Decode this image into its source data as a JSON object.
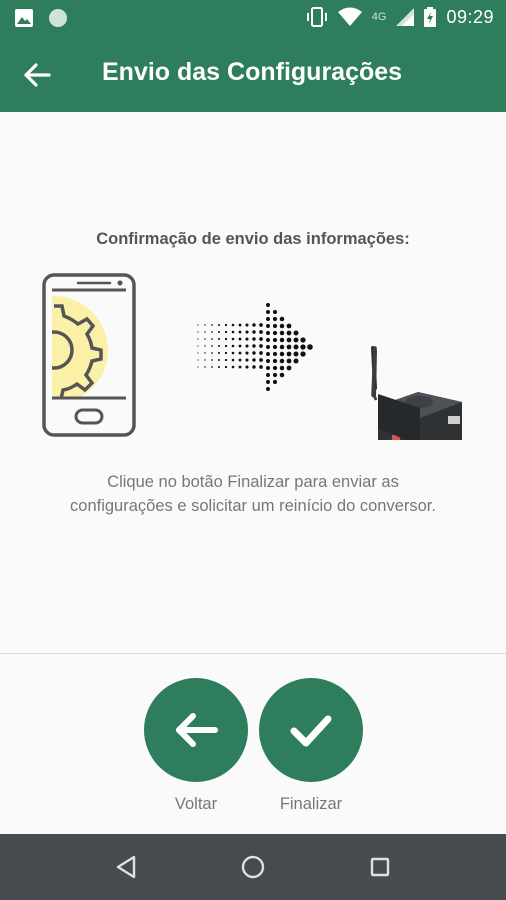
{
  "status_bar": {
    "time": "09:29",
    "network": "4G",
    "icons": [
      "image-icon",
      "circle-notification-icon",
      "vibrate-icon",
      "wifi-icon",
      "signal-icon",
      "battery-icon"
    ]
  },
  "app_bar": {
    "title": "Envio das Configurações",
    "back_icon": "arrow-left-icon"
  },
  "main": {
    "confirm_title": "Confirmação de envio das informações:",
    "info_text": "Clique no botão Finalizar para enviar as configurações e solicitar um reinício do conversor.",
    "illustration_icons": [
      "phone-gear-icon",
      "dotted-arrow-icon",
      "router-device-icon"
    ]
  },
  "actions": {
    "back_label": "Voltar",
    "finish_label": "Finalizar"
  },
  "nav_bar": {
    "icons": [
      "back-triangle-icon",
      "home-circle-icon",
      "recents-square-icon"
    ]
  },
  "colors": {
    "primary": "#2e7d5c",
    "nav_bar": "#454b4f",
    "accent_yellow": "#fbf0a8"
  }
}
